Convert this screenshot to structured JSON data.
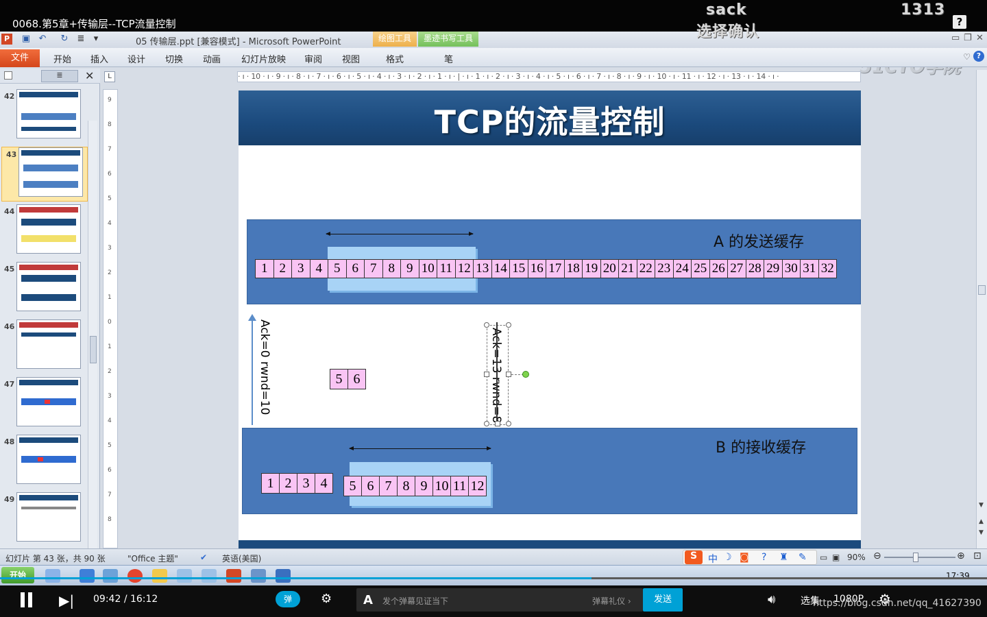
{
  "video": {
    "title": "0068.第5章+传输层--TCP流量控制",
    "danmu": [
      "sack",
      "选择确认",
      "1313"
    ],
    "time_current": "09:42",
    "time_separator": "/",
    "time_total": "16:12",
    "progress": 0.599,
    "danmu_toggle": "弹",
    "danmu_placeholder": "发个弹幕见证当下",
    "danmu_gift": "弹幕礼仪 ›",
    "send": "发送",
    "xuanji": "选集",
    "resolution": "1080P",
    "watermark": "https://blog.csdn.net/qq_41627390",
    "help": "?"
  },
  "ppt": {
    "window_title": "05 传输层.ppt [兼容模式]  -  Microsoft PowerPoint",
    "ctx_draw_tools": "绘图工具",
    "ctx_ink_tools": "墨迹书写工具",
    "logo": "51CTO学院",
    "tabs": {
      "file": "文件",
      "home": "开始",
      "insert": "插入",
      "design": "设计",
      "transitions": "切换",
      "animations": "动画",
      "slideshow": "幻灯片放映",
      "review": "审阅",
      "view": "视图",
      "format": "格式",
      "pen": "笔"
    },
    "thumb_numbers": [
      "42",
      "43",
      "44",
      "45",
      "46",
      "47",
      "48",
      "49"
    ],
    "active_slide": "43",
    "hruler": "· ı · 10 · ı · 9 · ı · 8 · ı · 7 · ı · 6 · ı · 5 · ı · 4 · ı · 3 · ı · 2 · ı · 1 · ı · | · ı · 1 · ı · 2 · ı · 3 · ı · 4 · ı · 5 · ı · 6 · ı · 7 · ı · 8 · ı · 9 · ı · 10 · ı · 11 · ı · 12 · ı · 13 · ı · 14 · ı ·",
    "vruler": [
      "9",
      "8",
      "7",
      "6",
      "5",
      "4",
      "3",
      "2",
      "1",
      "0",
      "1",
      "2",
      "3",
      "4",
      "5",
      "6",
      "7",
      "8"
    ],
    "status": {
      "slide_info": "幻灯片 第 43 张，共 90 张",
      "theme": "\"Office 主题\"",
      "language": "英语(美国)",
      "zoom": "90%"
    },
    "ime": {
      "zh": "中"
    },
    "clock": "17:39",
    "start": "开始"
  },
  "slide": {
    "title": "TCP的流量控制",
    "send_buffer_label": "A 的发送缓存",
    "recv_buffer_label": "B 的接收缓存",
    "send_cells": [
      "1",
      "2",
      "3",
      "4",
      "5",
      "6",
      "7",
      "8",
      "9",
      "10",
      "11",
      "12",
      "13",
      "14",
      "15",
      "16",
      "17",
      "18",
      "19",
      "20",
      "21",
      "22",
      "23",
      "24",
      "25",
      "26",
      "27",
      "28",
      "29",
      "30",
      "31",
      "32"
    ],
    "in_flight_cells": [
      "5",
      "6"
    ],
    "recv_delivered_cells": [
      "1",
      "2",
      "3",
      "4"
    ],
    "recv_window_cells": [
      "5",
      "6",
      "7",
      "8",
      "9",
      "10",
      "11",
      "12"
    ],
    "ack1": "Ack=0 rwnd=10",
    "ack2": "Ack=13 rwnd=8"
  }
}
